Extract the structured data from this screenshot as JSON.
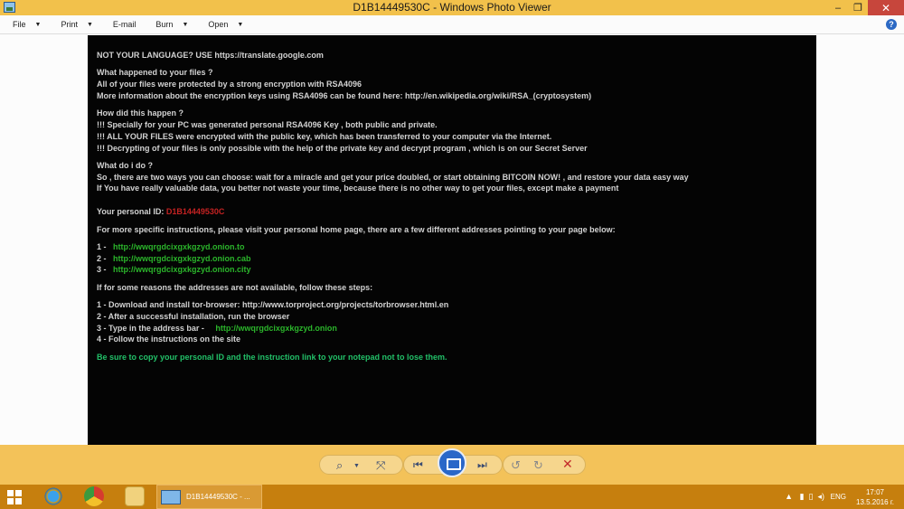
{
  "window": {
    "title": "D1B14449530C - Windows Photo Viewer",
    "minimize_glyph": "–",
    "maximize_glyph": "❐",
    "close_glyph": "✕"
  },
  "menu": {
    "file": "File",
    "print": "Print",
    "email": "E-mail",
    "burn": "Burn",
    "open": "Open",
    "help_glyph": "?"
  },
  "note": {
    "language": "NOT YOUR LANGUAGE? USE https://translate.google.com",
    "what_happened_h": "What happened to your files ?",
    "what_happened_1": "All of your files were protected by a strong encryption with RSA4096",
    "what_happened_2": "More information about the encryption keys using RSA4096 can be found here: http://en.wikipedia.org/wiki/RSA_(cryptosystem)",
    "how_h": "How did this happen ?",
    "how_1": "!!! Specially for your PC was generated personal RSA4096 Key , both public and private.",
    "how_2": "!!! ALL YOUR FILES were encrypted with the public key, which has been transferred to your computer via the Internet.",
    "how_3": "!!! Decrypting of your files is only possible with the help of the private key and decrypt program , which is on our Secret Server",
    "todo_h": "What do i do ?",
    "todo_1": "So , there are two ways you can choose: wait for a miracle and get your price doubled, or start obtaining BITCOIN NOW! , and restore your data easy way",
    "todo_2": "If You have really valuable data, you better not waste your time, because there is no other way to get your files, except make a payment",
    "personal_id_label": "Your personal ID: ",
    "personal_id": "D1B14449530C",
    "specific_instructions": "For more specific instructions, please visit your personal home page, there are a few different addresses pointing to your page below:",
    "addr_1_num": "1 -",
    "addr_1": "http://wwqrgdcixgxkgzyd.onion.to",
    "addr_2_num": "2 -",
    "addr_2": "http://wwqrgdcixgxkgzyd.onion.cab",
    "addr_3_num": "3 -",
    "addr_3": "http://wwqrgdcixgxkgzyd.onion.city",
    "unavailable": "If for some reasons the addresses are not available, follow these steps:",
    "step_1": "1 - Download and install tor-browser: http://www.torproject.org/projects/torbrowser.html.en",
    "step_2": "2 - After a successful installation, run the browser",
    "step_3_prefix": "3 - Type in the address bar -",
    "step_3_link": "http://wwqrgdcixgxkgzyd.onion",
    "step_4": "4 - Follow the instructions on the site",
    "final_note": "Be sure to copy your personal ID and the instruction link to your notepad not to lose them."
  },
  "toolbar": {
    "zoom_glyph": "⌕",
    "fit_glyph": "⤧",
    "prev_glyph": "⏮",
    "next_glyph": "⏭",
    "rotate_left_glyph": "↺",
    "rotate_right_glyph": "↻",
    "delete_glyph": "✕"
  },
  "taskbar": {
    "active_window": "D1B14449530C - ...",
    "language": "ENG",
    "time": "17:07",
    "date": "13.5.2016 г."
  }
}
